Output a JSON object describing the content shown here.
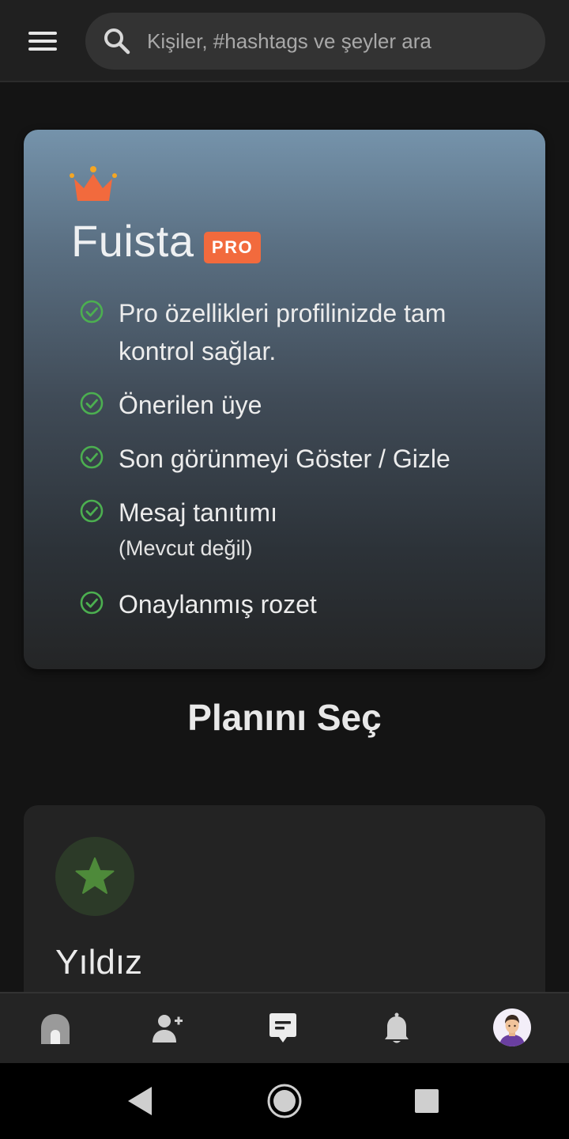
{
  "search": {
    "placeholder": "Kişiler, #hashtags ve şeyler ara"
  },
  "pro_card": {
    "brand": "Fuista",
    "badge": "PRO",
    "features": [
      {
        "text": "Pro özellikleri profilinizde tam",
        "text2": "kontrol sağlar."
      },
      {
        "text": "Önerilen üye"
      },
      {
        "text": "Son görünmeyi Göster / Gizle"
      },
      {
        "text": "Mesaj tanıtımı",
        "sub": "(Mevcut değil)"
      },
      {
        "text": "Onaylanmış rozet"
      }
    ]
  },
  "section_title": "Planını Seç",
  "plan": {
    "name": "Yıldız"
  },
  "bottom_nav": {
    "items": [
      {
        "icon": "home-icon"
      },
      {
        "icon": "add-user-icon"
      },
      {
        "icon": "chat-icon"
      },
      {
        "icon": "bell-icon"
      },
      {
        "icon": "avatar"
      }
    ]
  },
  "system_nav": {
    "items": [
      "back-icon",
      "home-circle-icon",
      "recents-icon"
    ]
  },
  "colors": {
    "accent": "#f26a3d",
    "check": "#4caf50",
    "plan_star": "#4e8a3a"
  }
}
